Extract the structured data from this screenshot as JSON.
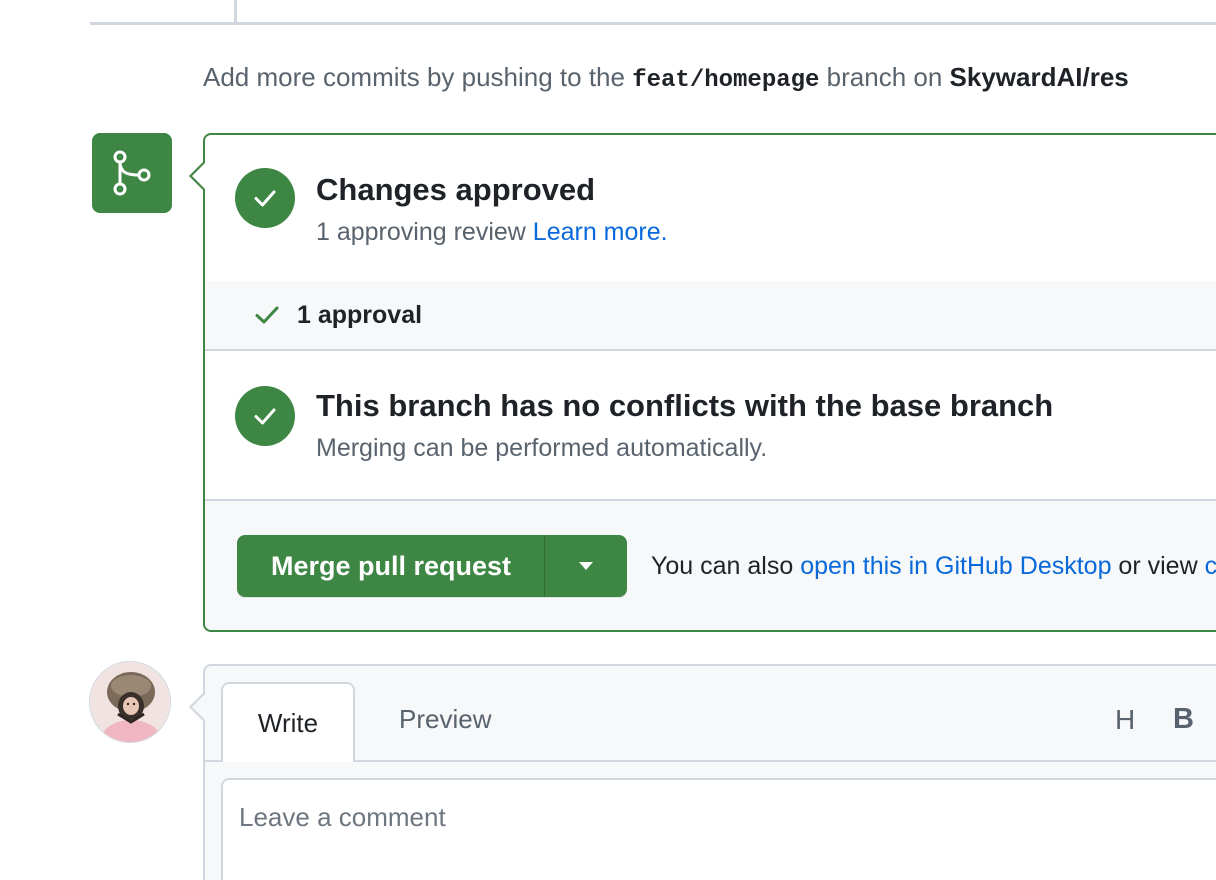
{
  "hint": {
    "prefix": "Add more commits by pushing to the ",
    "branch": "feat/homepage",
    "middle": " branch on ",
    "repo": "SkywardAI/res"
  },
  "approved": {
    "title": "Changes approved",
    "subtitle": "1 approving review ",
    "learn_more": "Learn more."
  },
  "approval_row": {
    "label": "1 approval"
  },
  "conflicts": {
    "title": "This branch has no conflicts with the base branch",
    "subtitle": "Merging can be performed automatically."
  },
  "merge": {
    "button_label": "Merge pull request",
    "note_prefix": "You can also ",
    "note_link": "open this in GitHub Desktop",
    "note_middle": " or view ",
    "note_tail": "c"
  },
  "comment": {
    "tab_write": "Write",
    "tab_preview": "Preview",
    "tool_heading": "H",
    "tool_bold": "B",
    "placeholder": "Leave a comment"
  },
  "colors": {
    "success_green": "#3e8644",
    "link_blue": "#0969da",
    "muted_text": "#59636e",
    "border": "#d0d7de",
    "subtle_bg": "#f6f8fa"
  },
  "icons": {
    "merge_state": "git-merge-icon",
    "status_ok": "check-circle-icon",
    "approval": "check-icon",
    "dropdown": "triangle-down-icon"
  }
}
